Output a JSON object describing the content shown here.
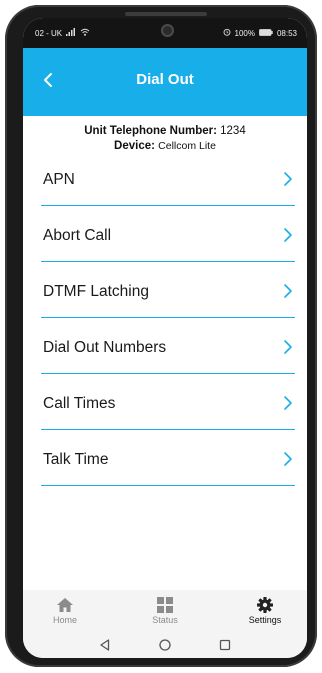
{
  "status_bar": {
    "carrier": "02 - UK",
    "battery": "100%",
    "time": "08:53"
  },
  "header": {
    "title": "Dial Out"
  },
  "info": {
    "telephone_label": "Unit Telephone Number:",
    "telephone_value": "1234",
    "device_label": "Device:",
    "device_value": "Cellcom Lite"
  },
  "menu": {
    "items": [
      {
        "label": "APN"
      },
      {
        "label": "Abort Call"
      },
      {
        "label": "DTMF Latching"
      },
      {
        "label": "Dial Out Numbers"
      },
      {
        "label": "Call Times"
      },
      {
        "label": "Talk Time"
      }
    ]
  },
  "tabs": {
    "home": "Home",
    "status": "Status",
    "settings": "Settings",
    "active": "settings"
  },
  "colors": {
    "accent": "#18aeea",
    "divider": "#19aee8"
  }
}
